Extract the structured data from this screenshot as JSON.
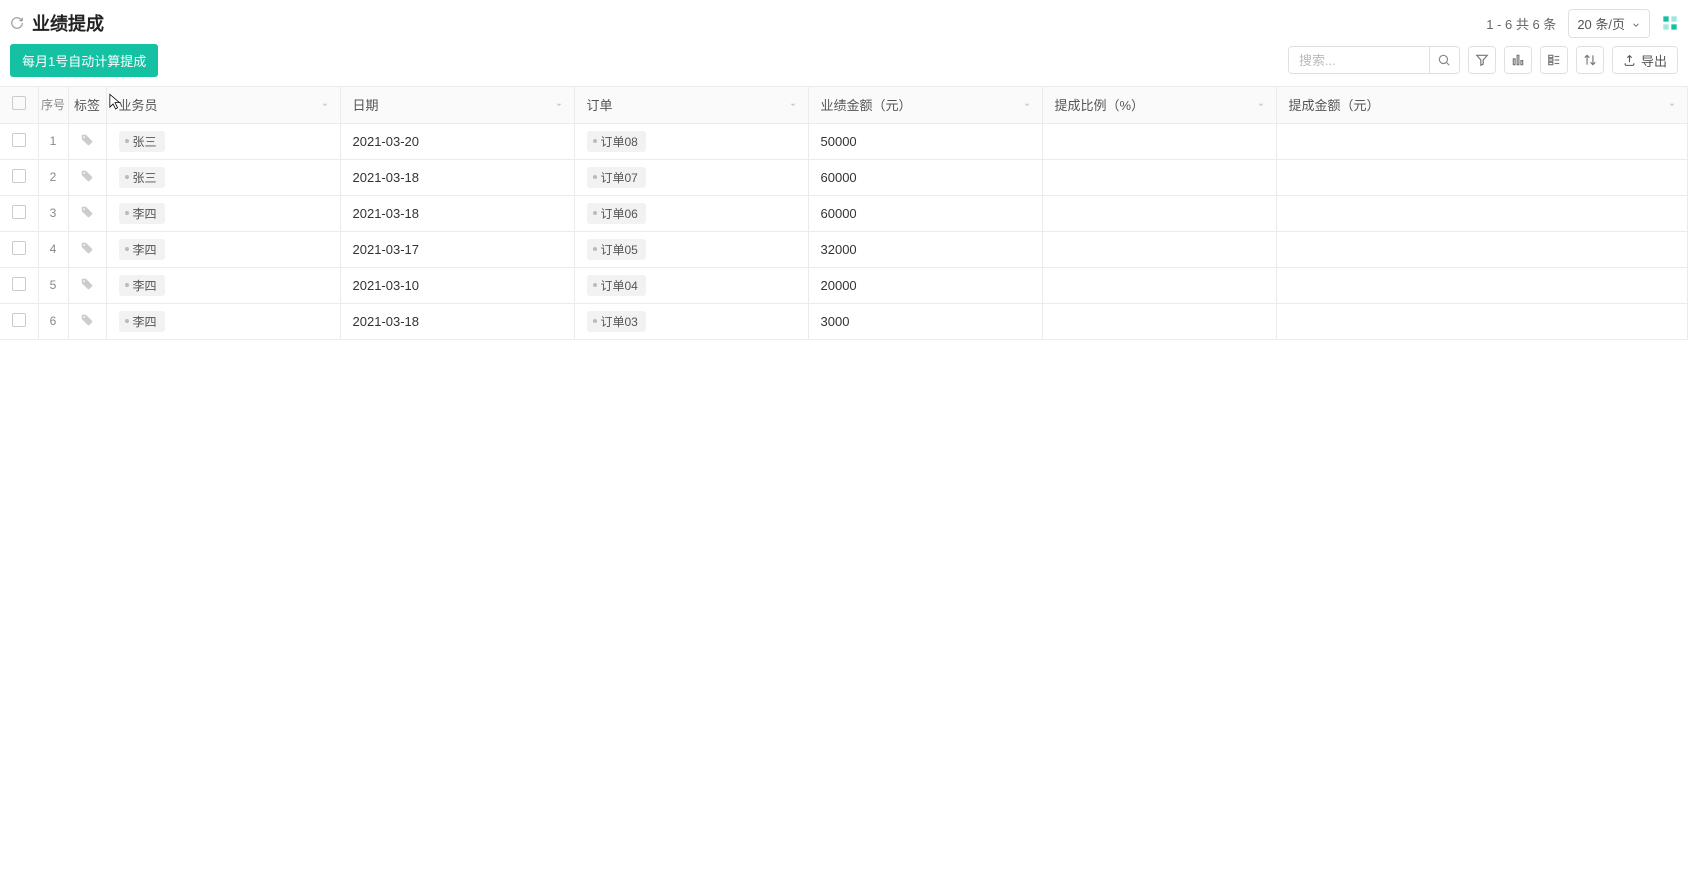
{
  "header": {
    "title": "业绩提成",
    "pagination_text": "1 - 6 共 6 条",
    "page_size_label": "20 条/页"
  },
  "toolbar": {
    "auto_calc_label": "每月1号自动计算提成",
    "search_placeholder": "搜索...",
    "export_label": "导出"
  },
  "columns": {
    "index": "序号",
    "tag": "标签",
    "salesperson": "业务员",
    "date": "日期",
    "order": "订单",
    "amount": "业绩金额（元）",
    "ratio": "提成比例（%）",
    "commission": "提成金额（元）"
  },
  "rows": [
    {
      "index": "1",
      "salesperson": "张三",
      "date": "2021-03-20",
      "order": "订单08",
      "amount": "50000",
      "ratio": "",
      "commission": ""
    },
    {
      "index": "2",
      "salesperson": "张三",
      "date": "2021-03-18",
      "order": "订单07",
      "amount": "60000",
      "ratio": "",
      "commission": ""
    },
    {
      "index": "3",
      "salesperson": "李四",
      "date": "2021-03-18",
      "order": "订单06",
      "amount": "60000",
      "ratio": "",
      "commission": ""
    },
    {
      "index": "4",
      "salesperson": "李四",
      "date": "2021-03-17",
      "order": "订单05",
      "amount": "32000",
      "ratio": "",
      "commission": ""
    },
    {
      "index": "5",
      "salesperson": "李四",
      "date": "2021-03-10",
      "order": "订单04",
      "amount": "20000",
      "ratio": "",
      "commission": ""
    },
    {
      "index": "6",
      "salesperson": "李四",
      "date": "2021-03-18",
      "order": "订单03",
      "amount": "3000",
      "ratio": "",
      "commission": ""
    }
  ],
  "colors": {
    "accent": "#14c2a3"
  },
  "icons": {
    "refresh": "refresh-icon",
    "apps": "apps-icon",
    "search": "search-icon",
    "filter": "filter-icon",
    "chart": "chart-icon",
    "group": "group-icon",
    "sort": "sort-icon",
    "export": "export-icon",
    "tag": "tag-icon",
    "chevron_down": "chevron-down-icon"
  }
}
